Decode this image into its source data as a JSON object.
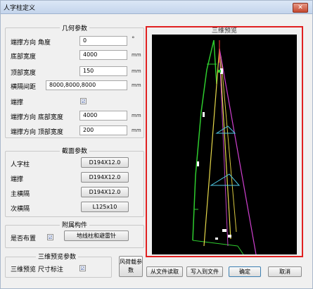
{
  "window": {
    "title": "人字柱定义",
    "close_glyph": "✕"
  },
  "geom": {
    "title": "几何参数",
    "rows": [
      {
        "label": "端撑方向 角度",
        "value": "0",
        "unit": "°"
      },
      {
        "label": "底部宽度",
        "value": "4000",
        "unit": "mm"
      },
      {
        "label": "顶部宽度",
        "value": "150",
        "unit": "mm"
      },
      {
        "label": "横隔间距",
        "value": "8000,8000,8000",
        "unit": "mm"
      },
      {
        "label": "端撑",
        "checked_glyph": "☑"
      },
      {
        "label": "端撑方向 底部宽度",
        "value": "4000",
        "unit": "mm"
      },
      {
        "label": "端撑方向 顶部宽度",
        "value": "200",
        "unit": "mm"
      }
    ]
  },
  "section": {
    "title": "截面参数",
    "rows": [
      {
        "label": "人字柱",
        "button": "D194X12.0"
      },
      {
        "label": "端撑",
        "button": "D194X12.0"
      },
      {
        "label": "主横隔",
        "button": "D194X12.0"
      },
      {
        "label": "次横隔",
        "button": "L125x10"
      }
    ]
  },
  "attach": {
    "title": "附属构件",
    "label": "是否布置",
    "button": "地线柱和避雷针",
    "checked_glyph": "☑"
  },
  "preview3d": {
    "title": "三维预览参数",
    "label": "三维预览 尺寸标注",
    "checked_glyph": "☑"
  },
  "viewport": {
    "title": "三维预览"
  },
  "buttons": {
    "wind": "风荷载参数",
    "read_file": "从文件读取",
    "write_file": "写入到文件",
    "ok": "确定",
    "cancel": "取消"
  },
  "colors": {
    "accent": "#e02020",
    "canvas_bg": "#000000"
  }
}
